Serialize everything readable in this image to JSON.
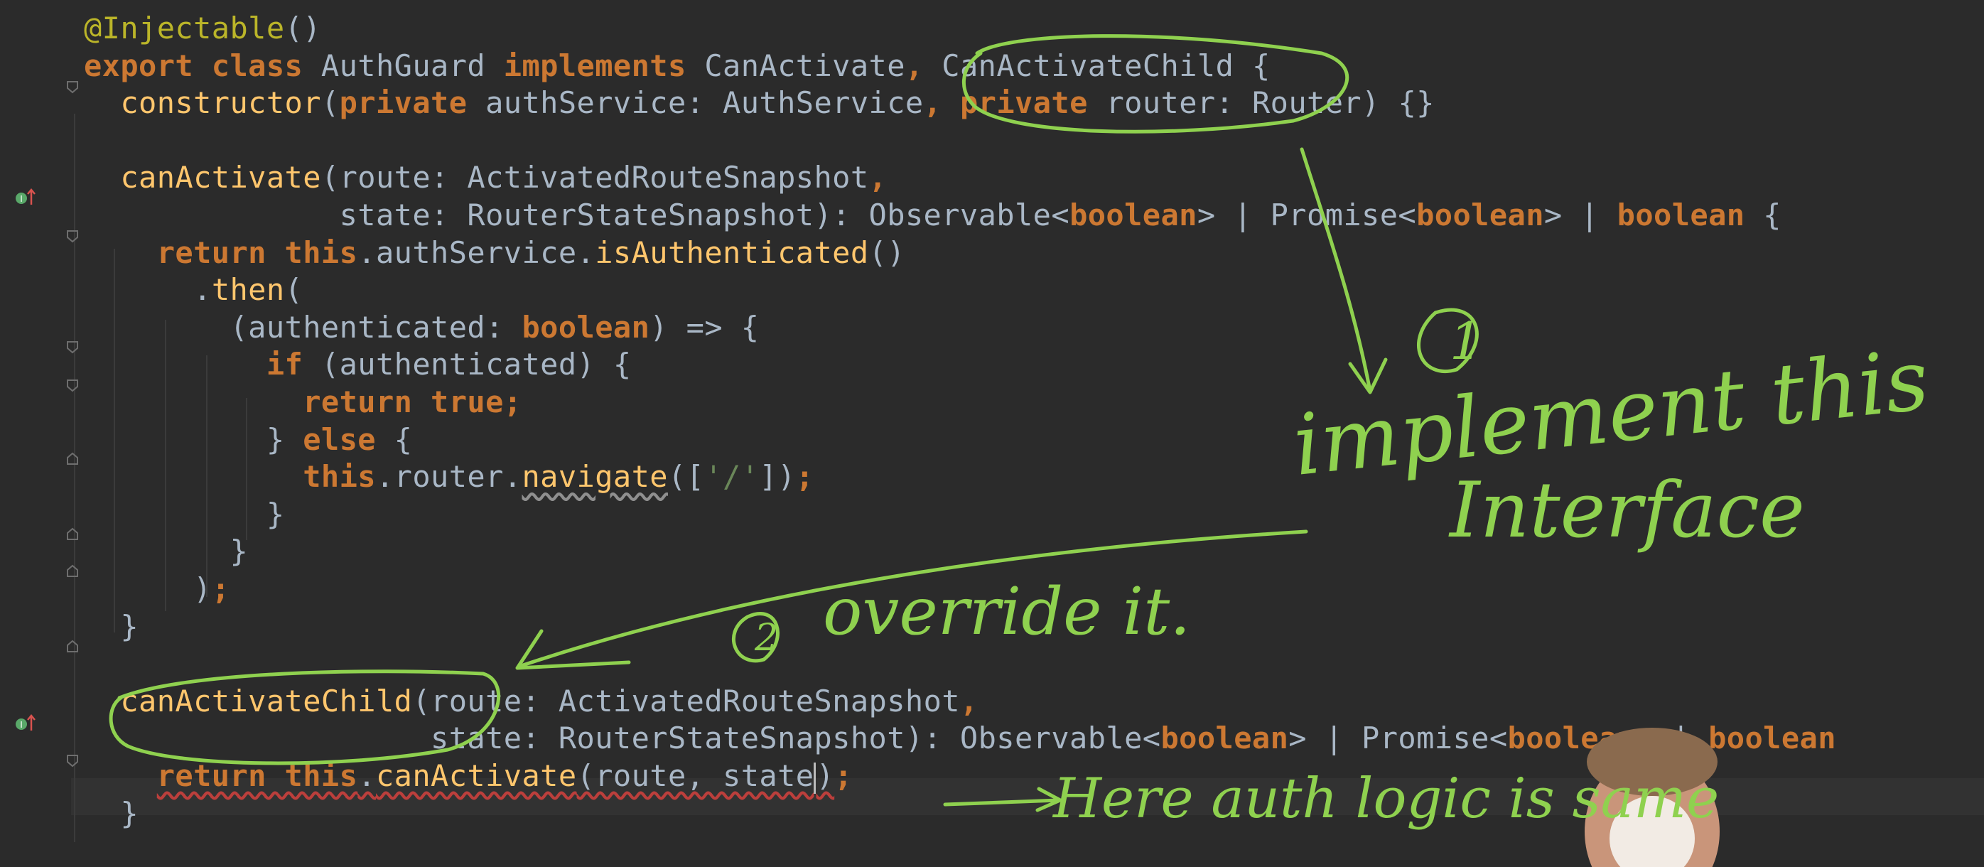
{
  "editor": {
    "lines": [
      [
        {
          "t": "@Injectable",
          "c": "ann"
        },
        {
          "t": "()",
          "c": "p"
        }
      ],
      [
        {
          "t": "export class ",
          "c": "kw"
        },
        {
          "t": "AuthGuard ",
          "c": "p"
        },
        {
          "t": "implements ",
          "c": "kw"
        },
        {
          "t": "CanActivate",
          "c": "p"
        },
        {
          "t": ", ",
          "c": "kw"
        },
        {
          "t": "CanActivateChild {",
          "c": "p"
        }
      ],
      [
        {
          "t": "  "
        },
        {
          "t": "constructor",
          "c": "fn"
        },
        {
          "t": "(",
          "c": "p"
        },
        {
          "t": "private ",
          "c": "kw"
        },
        {
          "t": "authService: AuthService",
          "c": "p"
        },
        {
          "t": ", ",
          "c": "kw"
        },
        {
          "t": "private ",
          "c": "kw"
        },
        {
          "t": "router: Router) {}",
          "c": "p"
        }
      ],
      [],
      [
        {
          "t": "  "
        },
        {
          "t": "canActivate",
          "c": "fn"
        },
        {
          "t": "(route: ActivatedRouteSnapshot",
          "c": "p"
        },
        {
          "t": ",",
          "c": "kw"
        }
      ],
      [
        {
          "t": "              state: RouterStateSnapshot): Observable<",
          "c": "p"
        },
        {
          "t": "boolean",
          "c": "kw"
        },
        {
          "t": "> | Promise<",
          "c": "p"
        },
        {
          "t": "boolean",
          "c": "kw"
        },
        {
          "t": "> | ",
          "c": "p"
        },
        {
          "t": "boolean ",
          "c": "kw"
        },
        {
          "t": "{",
          "c": "p"
        }
      ],
      [
        {
          "t": "    "
        },
        {
          "t": "return this",
          "c": "kw"
        },
        {
          "t": ".authService.",
          "c": "p"
        },
        {
          "t": "isAuthenticated",
          "c": "fn"
        },
        {
          "t": "()",
          "c": "p"
        }
      ],
      [
        {
          "t": "      ."
        },
        {
          "t": "then",
          "c": "fn"
        },
        {
          "t": "(",
          "c": "p"
        }
      ],
      [
        {
          "t": "        (authenticated: ",
          "c": "p"
        },
        {
          "t": "boolean",
          "c": "kw"
        },
        {
          "t": ") => {",
          "c": "p"
        }
      ],
      [
        {
          "t": "          "
        },
        {
          "t": "if ",
          "c": "kw"
        },
        {
          "t": "(authenticated) {",
          "c": "p"
        }
      ],
      [
        {
          "t": "            "
        },
        {
          "t": "return true;",
          "c": "kw"
        }
      ],
      [
        {
          "t": "          } ",
          "c": "p"
        },
        {
          "t": "else ",
          "c": "kw"
        },
        {
          "t": "{",
          "c": "p"
        }
      ],
      [
        {
          "t": "            "
        },
        {
          "t": "this",
          "c": "kw"
        },
        {
          "t": ".router.",
          "c": "p"
        },
        {
          "t": "navigate",
          "c": "fn sq"
        },
        {
          "t": "([",
          "c": "p"
        },
        {
          "t": "'/'",
          "c": "str"
        },
        {
          "t": "])",
          "c": "p"
        },
        {
          "t": ";",
          "c": "kw"
        }
      ],
      [
        {
          "t": "          }",
          "c": "p"
        }
      ],
      [
        {
          "t": "        }",
          "c": "p"
        }
      ],
      [
        {
          "t": "      )",
          "c": "p"
        },
        {
          "t": ";",
          "c": "kw"
        }
      ],
      [
        {
          "t": "  }",
          "c": "p"
        }
      ],
      [],
      [
        {
          "t": "  "
        },
        {
          "t": "canActivateChild",
          "c": "fn"
        },
        {
          "t": "(route: ActivatedRouteSnapshot",
          "c": "p"
        },
        {
          "t": ",",
          "c": "kw"
        }
      ],
      [
        {
          "t": "                   state: RouterStateSnapshot): Observable<",
          "c": "p"
        },
        {
          "t": "boolean",
          "c": "kw"
        },
        {
          "t": "> | Promise<",
          "c": "p"
        },
        {
          "t": "boolean",
          "c": "kw"
        },
        {
          "t": "> | ",
          "c": "p"
        },
        {
          "t": "boolean",
          "c": "kw"
        }
      ],
      [
        {
          "t": "    "
        },
        {
          "t": "return this",
          "c": "kw sqr"
        },
        {
          "t": ".",
          "c": "p sqr"
        },
        {
          "t": "canActivate",
          "c": "fn sqr"
        },
        {
          "t": "(route, state",
          "c": "p sqr"
        },
        {
          "t": "CARET"
        },
        {
          "t": ")",
          "c": "p sqr"
        },
        {
          "t": ";",
          "c": "kw"
        }
      ],
      [
        {
          "t": "  }",
          "c": "p"
        }
      ]
    ]
  },
  "annotations": {
    "step1_number": "1",
    "step1_text_line1": "implement this",
    "step1_text_line2": "Interface",
    "step2_number": "2",
    "step2_text": "override it.",
    "note_text": "Here auth logic is same"
  },
  "colors": {
    "background": "#2b2b2b",
    "keyword": "#cc7832",
    "function": "#ffc66d",
    "identifier": "#a9b7c6",
    "string": "#6a8759",
    "annotation": "#bbb529",
    "ink": "#8fd14f",
    "gutter_marker": "#59a869"
  },
  "gutter": {
    "implements_marker_icon": "implements-marker-icon",
    "fold_icon": "fold-toggle-icon"
  }
}
